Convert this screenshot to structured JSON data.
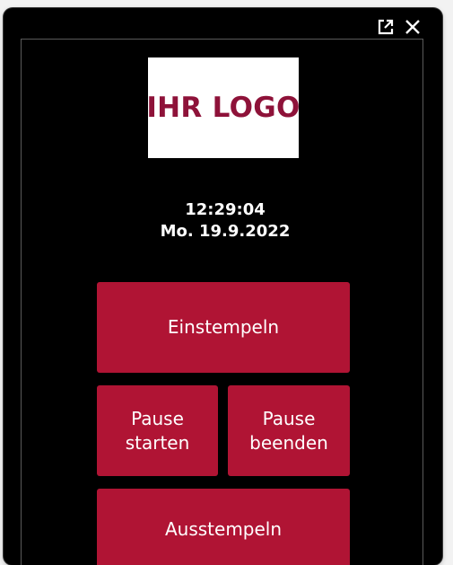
{
  "window": {
    "external_icon": "external-link-icon",
    "close_icon": "close-icon"
  },
  "logo": {
    "text": "IHR LOGO",
    "text_color": "#8e1239"
  },
  "clock": {
    "time": "12:29:04",
    "date": "Mo. 19.9.2022"
  },
  "buttons": {
    "clock_in": "Einstempeln",
    "pause_start_line1": "Pause",
    "pause_start_line2": "starten",
    "pause_end_line1": "Pause",
    "pause_end_line2": "beenden",
    "clock_out": "Ausstempeln"
  },
  "colors": {
    "background": "#000000",
    "button": "#b01434",
    "button_text": "#ffffff"
  }
}
